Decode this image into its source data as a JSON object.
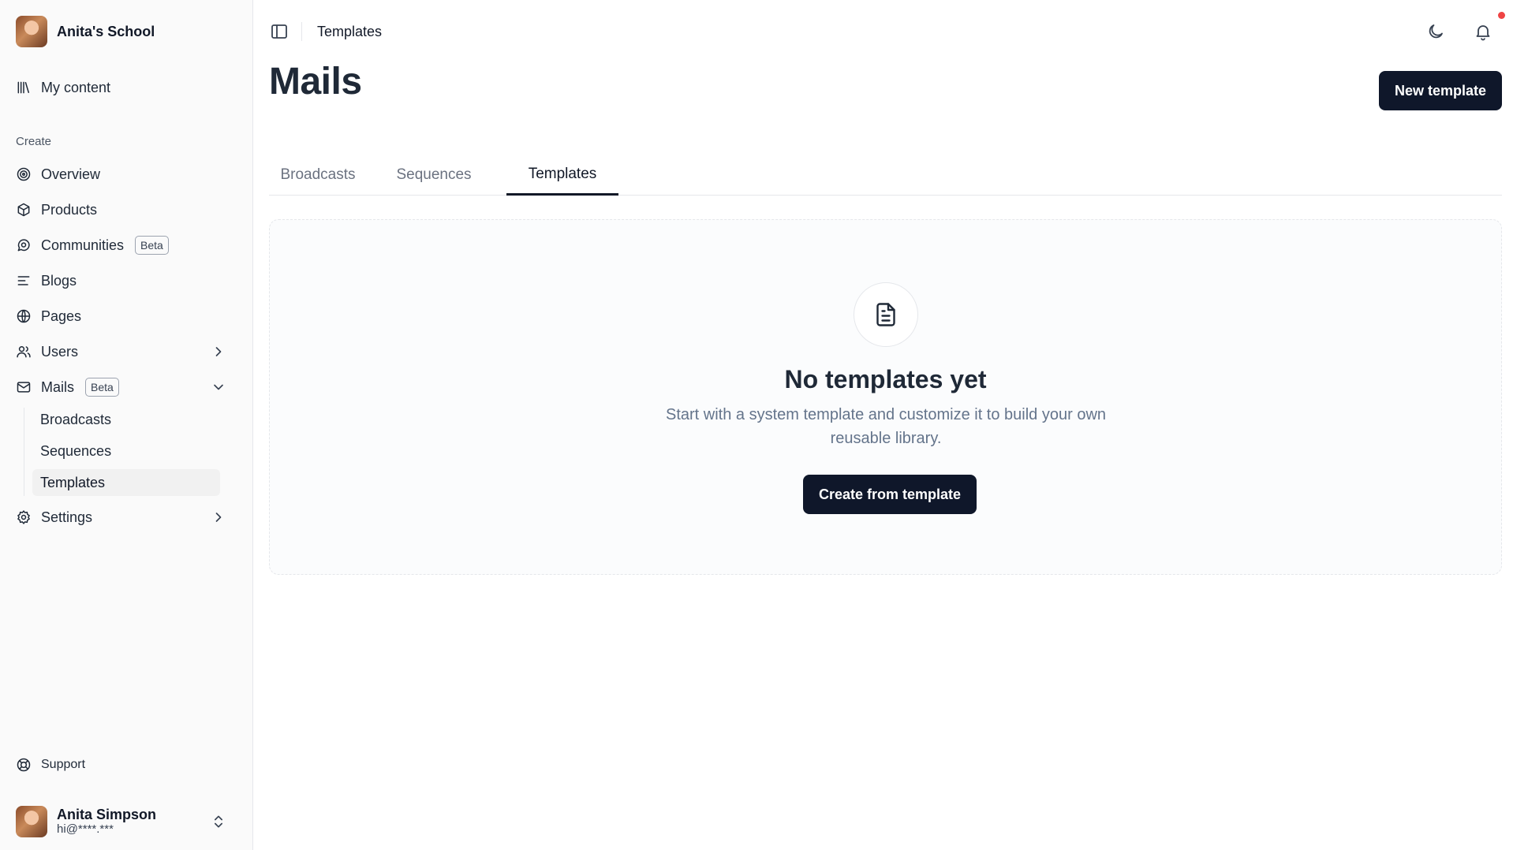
{
  "sidebar": {
    "school_name": "Anita's School",
    "my_content": "My content",
    "section_create": "Create",
    "items": [
      {
        "label": "Overview"
      },
      {
        "label": "Products"
      },
      {
        "label": "Communities",
        "badge": "Beta"
      },
      {
        "label": "Blogs"
      },
      {
        "label": "Pages"
      },
      {
        "label": "Users"
      },
      {
        "label": "Mails",
        "badge": "Beta"
      },
      {
        "label": "Settings"
      }
    ],
    "mails_sub": [
      {
        "label": "Broadcasts"
      },
      {
        "label": "Sequences"
      },
      {
        "label": "Templates",
        "active": true
      }
    ],
    "support": "Support",
    "user": {
      "name": "Anita Simpson",
      "email": "hi@****.***"
    }
  },
  "topbar": {
    "breadcrumb": "Templates",
    "has_notification": true
  },
  "main": {
    "title": "Mails",
    "new_template_label": "New template",
    "tabs": [
      {
        "label": "Broadcasts"
      },
      {
        "label": "Sequences"
      },
      {
        "label": "Templates",
        "active": true
      }
    ],
    "empty_state": {
      "icon": "file-text-icon",
      "title": "No templates yet",
      "description": "Start with a system template and customize it to build your own reusable library.",
      "button_label": "Create from template"
    }
  },
  "colors": {
    "primary_button": "#0f172a",
    "notification_dot": "#ef4444",
    "sidebar_bg": "#fafafa"
  }
}
